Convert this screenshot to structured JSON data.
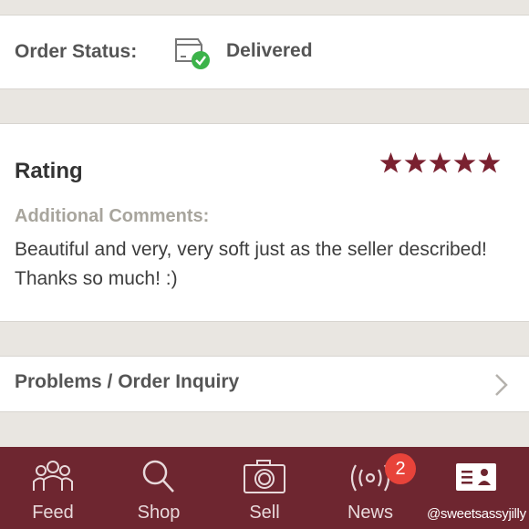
{
  "order_status": {
    "label": "Order Status:",
    "value": "Delivered",
    "icon": "package-delivered-icon",
    "check_color": "#3cb34a"
  },
  "rating": {
    "label": "Rating",
    "stars": 5,
    "star_color": "#7a2130",
    "comments_label": "Additional Comments:",
    "comments_text": "Beautiful and very, very soft just as the seller described! Thanks so much! :)"
  },
  "inquiry": {
    "label": "Problems / Order Inquiry",
    "icon": "chevron-right-icon"
  },
  "tabbar": {
    "background": "#6e2630",
    "tabs": [
      {
        "label": "Feed",
        "icon": "people-icon"
      },
      {
        "label": "Shop",
        "icon": "search-icon"
      },
      {
        "label": "Sell",
        "icon": "camera-icon"
      },
      {
        "label": "News",
        "icon": "broadcast-icon",
        "badge": "2"
      },
      {
        "label": "@sweetsassyjilly",
        "icon": "profile-card-icon"
      }
    ]
  }
}
